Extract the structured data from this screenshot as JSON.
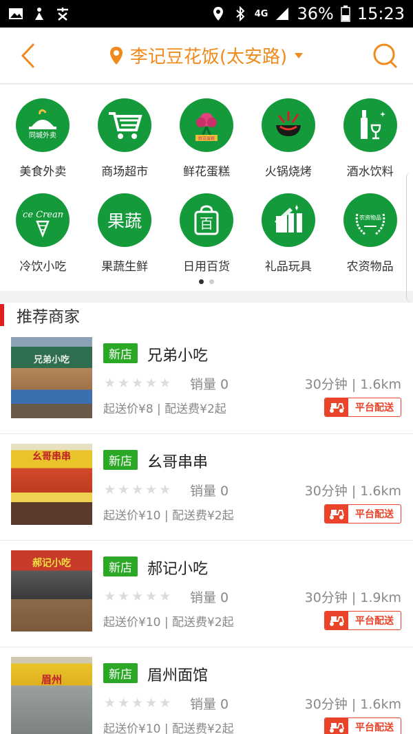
{
  "status_bar": {
    "network": "4G",
    "battery": "36%",
    "time": "15:23"
  },
  "header": {
    "location": "李记豆花饭(太安路)"
  },
  "categories": [
    {
      "label": "美食外卖",
      "icon": "food-delivery-icon",
      "icon_text": "同城外卖"
    },
    {
      "label": "商场超市",
      "icon": "shopping-cart-icon",
      "icon_text": ""
    },
    {
      "label": "鲜花蛋糕",
      "icon": "flower-cake-icon",
      "icon_text": "鲜花蛋糕"
    },
    {
      "label": "火锅烧烤",
      "icon": "hotpot-icon",
      "icon_text": ""
    },
    {
      "label": "酒水饮料",
      "icon": "wine-bottle-icon",
      "icon_text": ""
    },
    {
      "label": "冷饮小吃",
      "icon": "ice-cream-icon",
      "icon_text": "Ice Cream"
    },
    {
      "label": "果蔬生鲜",
      "icon": "fruit-veg-icon",
      "icon_text": "果蔬"
    },
    {
      "label": "日用百货",
      "icon": "shopping-bag-icon",
      "icon_text": "百"
    },
    {
      "label": "礼品玩具",
      "icon": "gift-box-icon",
      "icon_text": ""
    },
    {
      "label": "农资物品",
      "icon": "wheat-wreath-icon",
      "icon_text": "农资物品"
    }
  ],
  "pager": {
    "pages": 2,
    "active": 1
  },
  "section": {
    "title": "推荐商家"
  },
  "merchants": [
    {
      "badge": "新店",
      "name": "兄弟小吃",
      "sales": "销量 0",
      "distance": "30分钟 | 1.6km",
      "fees": "起送价¥8 | 配送费¥2起",
      "delivery": "平台配送",
      "sign_text": "兄弟小吃"
    },
    {
      "badge": "新店",
      "name": "幺哥串串",
      "sales": "销量 0",
      "distance": "30分钟 | 1.6km",
      "fees": "起送价¥10 | 配送费¥2起",
      "delivery": "平台配送",
      "sign_text": "幺哥串串"
    },
    {
      "badge": "新店",
      "name": "郝记小吃",
      "sales": "销量 0",
      "distance": "30分钟 | 1.9km",
      "fees": "起送价¥10 | 配送费¥2起",
      "delivery": "平台配送",
      "sign_text": "郝记小吃"
    },
    {
      "badge": "新店",
      "name": "眉州面馆",
      "sales": "销量 0",
      "distance": "30分钟 | 1.6km",
      "fees": "起送价¥10 | 配送费¥2起",
      "delivery": "平台配送",
      "sign_text": "眉州"
    }
  ],
  "colors": {
    "accent": "#f08a1c",
    "category_green": "#159a3b",
    "new_badge": "#2aa826",
    "delivery_red": "#e9432a",
    "section_red": "#e02020"
  }
}
